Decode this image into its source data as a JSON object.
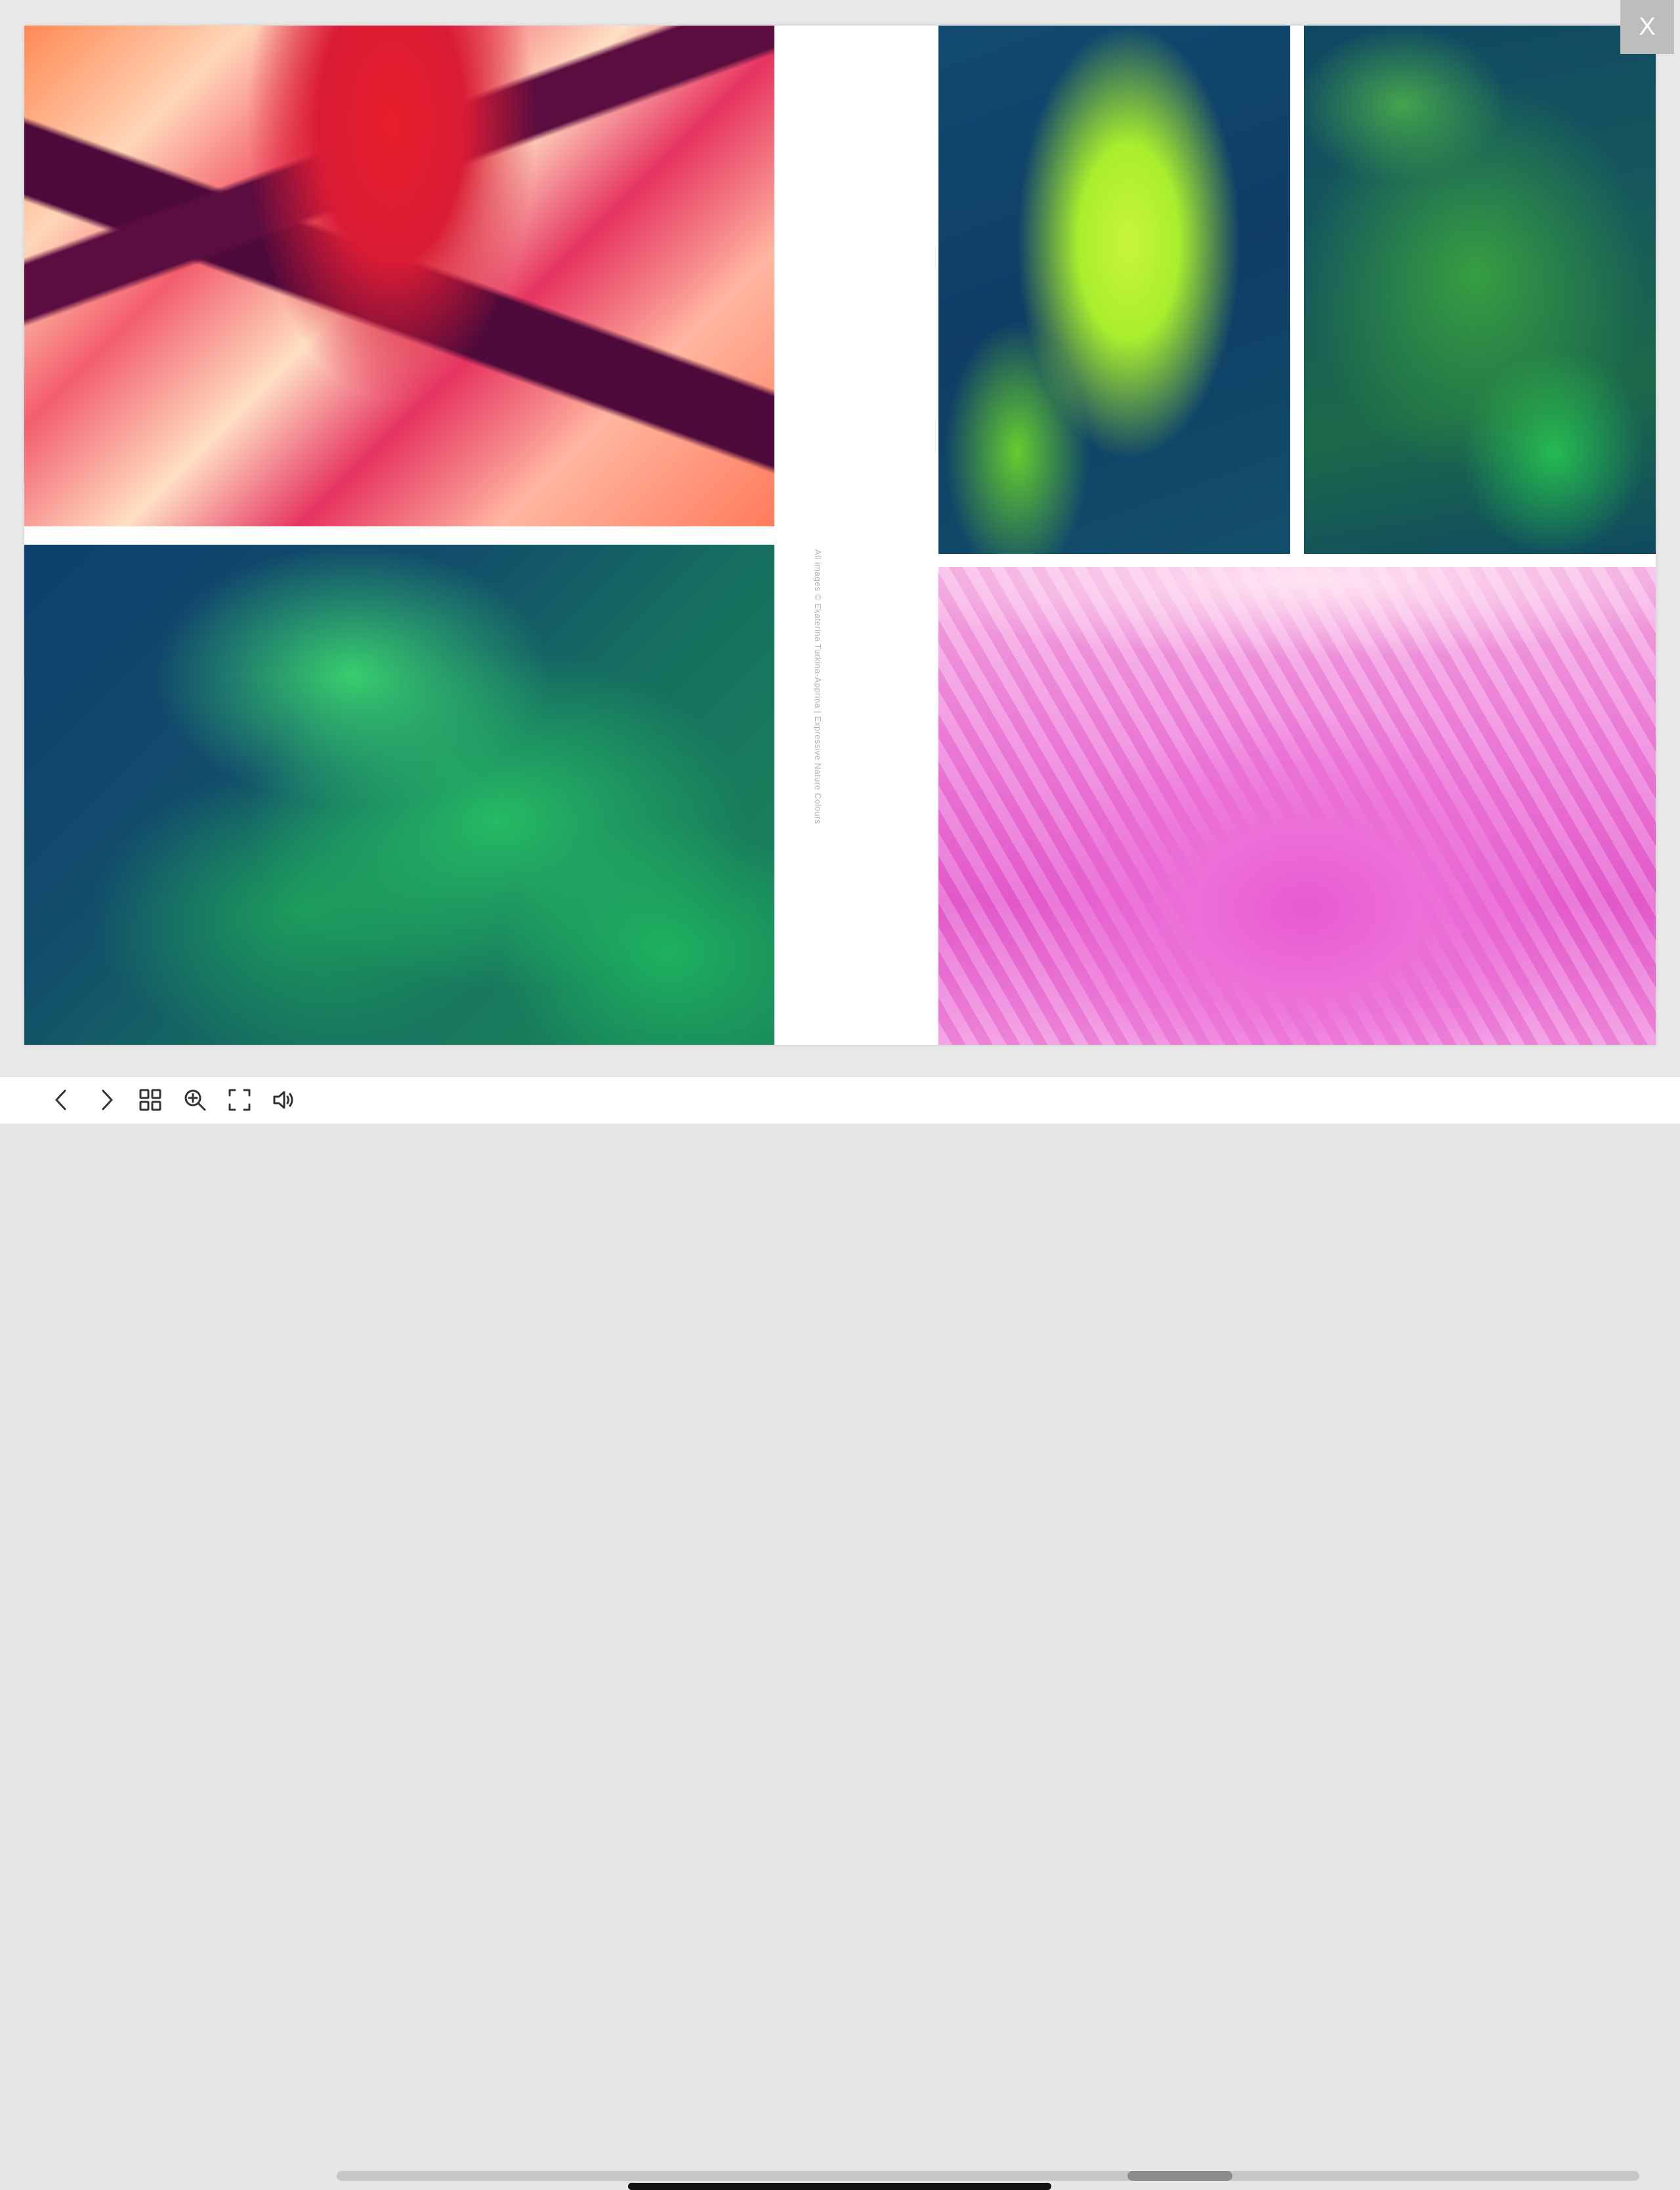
{
  "viewer": {
    "close_label": "X",
    "credit": "All images © Ekaterina Turkina-Apprina | Expressive Nature Colours"
  },
  "toolbar": {
    "buttons": [
      "previous-page",
      "next-page",
      "thumbnails",
      "zoom-in",
      "fullscreen",
      "sound"
    ]
  },
  "scroll": {
    "position": 0.66
  },
  "colors": {
    "toolbar_bg": "#ffffff",
    "close_bg": "#bdbdbd",
    "scroll_track": "#c7c7c7",
    "scroll_thumb": "#8d8d8d"
  }
}
